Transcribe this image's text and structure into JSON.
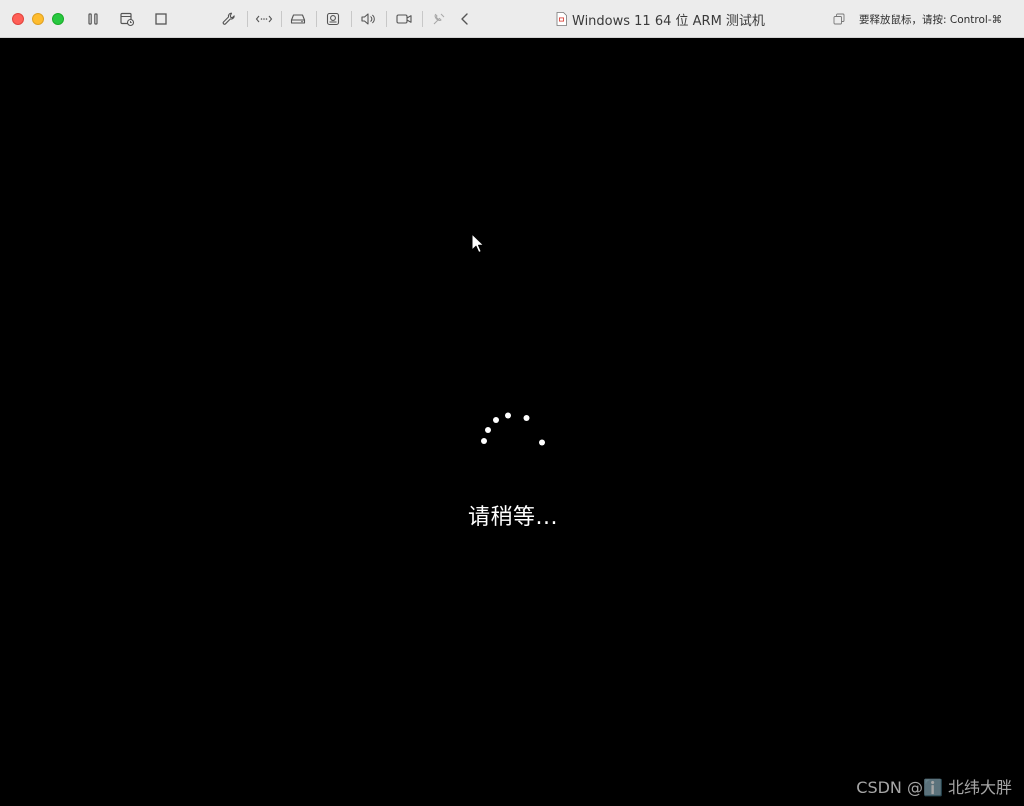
{
  "window": {
    "title": "Windows 11 64 位 ARM 测试机",
    "release_hint": "要释放鼠标，请按: Control-⌘"
  },
  "toolbar": {
    "icons": [
      "pause-icon",
      "snapshot-icon",
      "stop-icon",
      "settings-wrench-icon",
      "network-icon",
      "disk-icon",
      "camera-device-icon",
      "audio-icon",
      "video-camera-icon",
      "usb-icon",
      "chevron-left-icon"
    ]
  },
  "screen": {
    "status_text": "请稍等...",
    "watermark": "CSDN @ℹ️ 北纬大胖"
  },
  "colors": {
    "close": "#ff5f57",
    "minimize": "#febc2e",
    "zoom": "#28c840",
    "titlebar": "#ececec",
    "screen": "#000000"
  }
}
